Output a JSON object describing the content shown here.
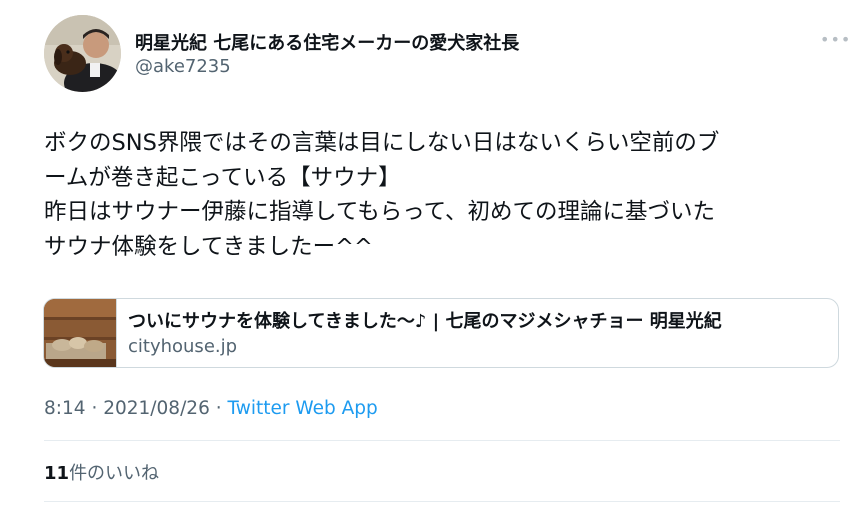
{
  "author": {
    "display_name": "明星光紀 七尾にある住宅メーカーの愛犬家社長",
    "handle": "@ake7235"
  },
  "more_icon": "more-horizontal-icon",
  "tweet": {
    "lines": [
      "ボクのSNS界隈ではその言葉は目にしない日はないくらい空前のブ",
      "ームが巻き起こっている【サウナ】",
      "昨日はサウナー伊藤に指導してもらって、初めての理論に基づいた",
      "サウナ体験をしてきましたー^^"
    ]
  },
  "link_card": {
    "title": "ついにサウナを体験してきました～♪ | 七尾のマジメシャチョー 明星光紀",
    "domain": "cityhouse.jp"
  },
  "meta": {
    "time": "8:14",
    "separator": "·",
    "date": "2021/08/26",
    "source": "Twitter Web App"
  },
  "likes": {
    "count": "11",
    "label": "件のいいね"
  },
  "colors": {
    "text": "#0f1419",
    "secondary": "#536471",
    "link": "#1d9bf0",
    "border": "#cfd9de"
  }
}
